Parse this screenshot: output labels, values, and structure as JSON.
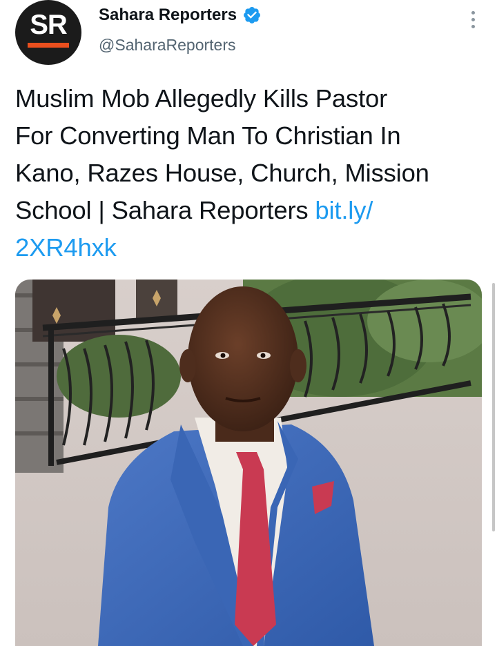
{
  "tweet": {
    "avatar": {
      "text": "SR",
      "accent_color": "#ea4f1e",
      "background_color": "#1b1b1b"
    },
    "author": {
      "display_name": "Sahara Reporters",
      "handle": "@SaharaReporters",
      "verified_icon": "verified-badge-icon",
      "verified_color": "#1d9bf0"
    },
    "more_icon": "more-vertical-icon",
    "text_lines": [
      "Muslim Mob Allegedly Kills Pastor",
      "For Converting Man To Christian In",
      "Kano, Razes House, Church, Mission",
      "School | Sahara Reporters "
    ],
    "link_part1": "bit.ly/",
    "link_part2": "2XR4hxk",
    "link_color": "#1d9bf0"
  }
}
